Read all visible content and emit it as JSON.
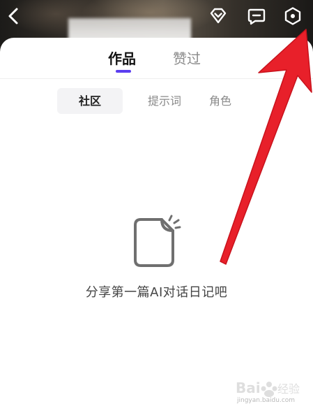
{
  "header": {
    "back_icon": "chevron-left-icon",
    "icons": [
      "diamond-icon",
      "chat-icon",
      "settings-hexagon-icon"
    ]
  },
  "tabs": [
    {
      "label": "作品",
      "active": true
    },
    {
      "label": "赞过",
      "active": false
    }
  ],
  "subtabs": [
    {
      "label": "社区",
      "active": true
    },
    {
      "label": "提示词",
      "active": false
    },
    {
      "label": "角色",
      "active": false
    }
  ],
  "empty_state": {
    "icon": "document-icon",
    "text": "分享第一篇AI对话日记吧"
  },
  "annotation": {
    "arrow_color": "#e8202a",
    "points_to": "settings-hexagon-icon"
  },
  "watermark": {
    "text": "Bai du 经验",
    "subtext": "jingyan.baidu.com"
  },
  "colors": {
    "accent": "#5b3ef0",
    "header_dark": "#2a2622"
  }
}
